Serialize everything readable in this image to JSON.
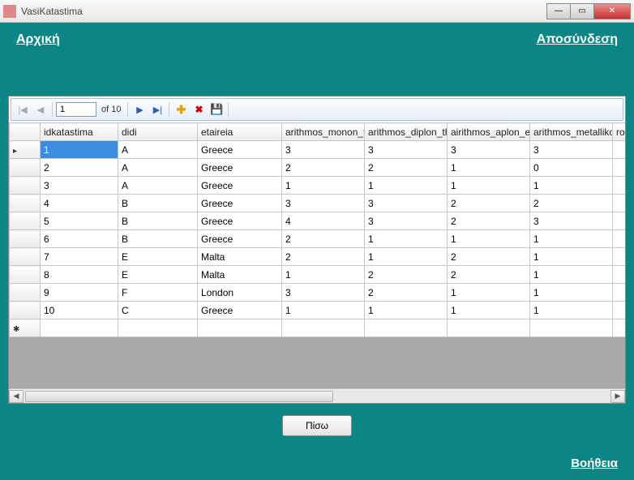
{
  "window": {
    "title": "VasiKatastima"
  },
  "links": {
    "home": "Αρχική",
    "logout": "Αποσύνδεση",
    "help": "Βοήθεια"
  },
  "navigator": {
    "current": "1",
    "of_text": "of 10"
  },
  "buttons": {
    "back": "Πίσω"
  },
  "grid": {
    "columns": [
      "idkatastima",
      "didi",
      "etaireia",
      "arithmos_monon_th",
      "arithmos_diplon_thi",
      "airithmos_aplon_exc",
      "arithmos_metallikon",
      "rol"
    ],
    "rows": [
      {
        "id": "1",
        "didi": "A",
        "etaireia": "Greece",
        "c1": "3",
        "c2": "3",
        "c3": "3",
        "c4": "3"
      },
      {
        "id": "2",
        "didi": "A",
        "etaireia": "Greece",
        "c1": "2",
        "c2": "2",
        "c3": "1",
        "c4": "0"
      },
      {
        "id": "3",
        "didi": "A",
        "etaireia": "Greece",
        "c1": "1",
        "c2": "1",
        "c3": "1",
        "c4": "1"
      },
      {
        "id": "4",
        "didi": "B",
        "etaireia": "Greece",
        "c1": "3",
        "c2": "3",
        "c3": "2",
        "c4": "2"
      },
      {
        "id": "5",
        "didi": "B",
        "etaireia": "Greece",
        "c1": "4",
        "c2": "3",
        "c3": "2",
        "c4": "3"
      },
      {
        "id": "6",
        "didi": "B",
        "etaireia": "Greece",
        "c1": "2",
        "c2": "1",
        "c3": "1",
        "c4": "1"
      },
      {
        "id": "7",
        "didi": "E",
        "etaireia": "Malta",
        "c1": "2",
        "c2": "1",
        "c3": "2",
        "c4": "1"
      },
      {
        "id": "8",
        "didi": "E",
        "etaireia": "Malta",
        "c1": "1",
        "c2": "2",
        "c3": "2",
        "c4": "1"
      },
      {
        "id": "9",
        "didi": "F",
        "etaireia": "London",
        "c1": "3",
        "c2": "2",
        "c3": "1",
        "c4": "1"
      },
      {
        "id": "10",
        "didi": "C",
        "etaireia": "Greece",
        "c1": "1",
        "c2": "1",
        "c3": "1",
        "c4": "1"
      }
    ]
  }
}
